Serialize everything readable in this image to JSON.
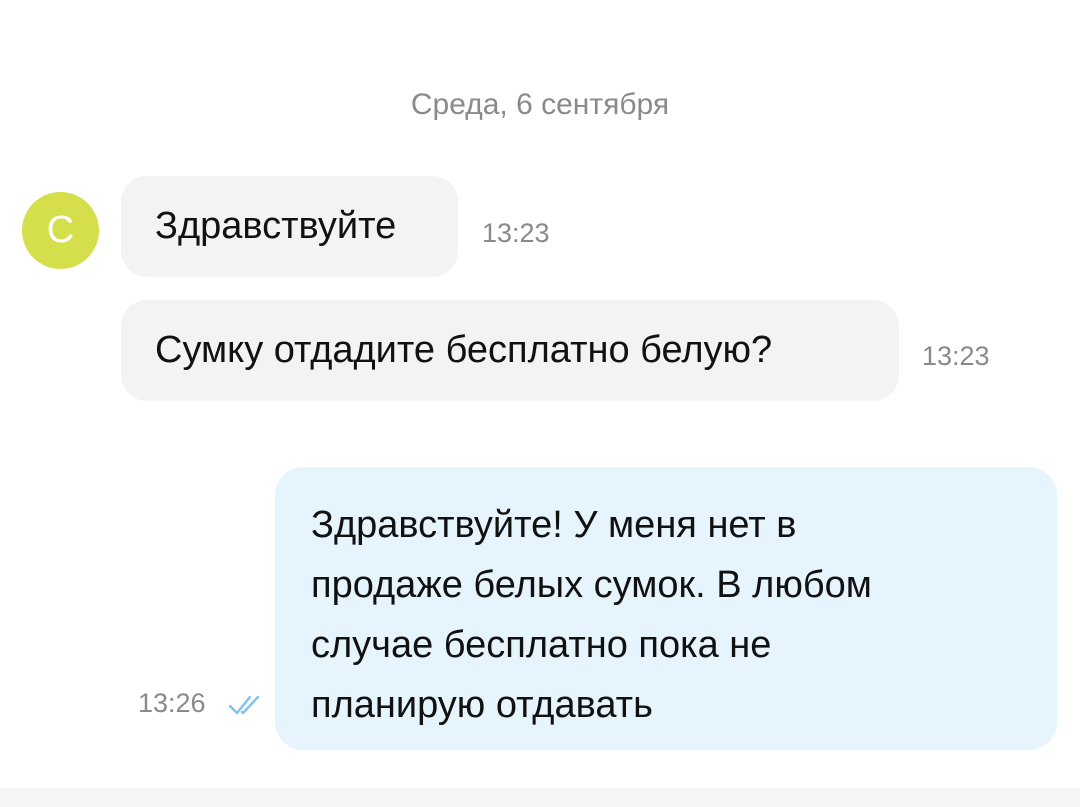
{
  "colors": {
    "avatar_bg": "#d5df4b",
    "incoming_bubble": "#f3f3f3",
    "outgoing_bubble": "#e6f4fd",
    "read_check": "#7ec3ec"
  },
  "date_separator": "Среда, 6 сентября",
  "contact": {
    "avatar_letter": "С"
  },
  "messages": [
    {
      "direction": "incoming",
      "text": "Здравствуйте",
      "time": "13:23"
    },
    {
      "direction": "incoming",
      "text": "Сумку отдадите бесплатно белую?",
      "time": "13:23"
    },
    {
      "direction": "outgoing",
      "lines": [
        "Здравствуйте! У меня нет в",
        "продаже белых сумок. В любом",
        "случае бесплатно пока не",
        "планирую отдавать"
      ],
      "time": "13:26",
      "status_icon": "double-check-icon"
    }
  ]
}
